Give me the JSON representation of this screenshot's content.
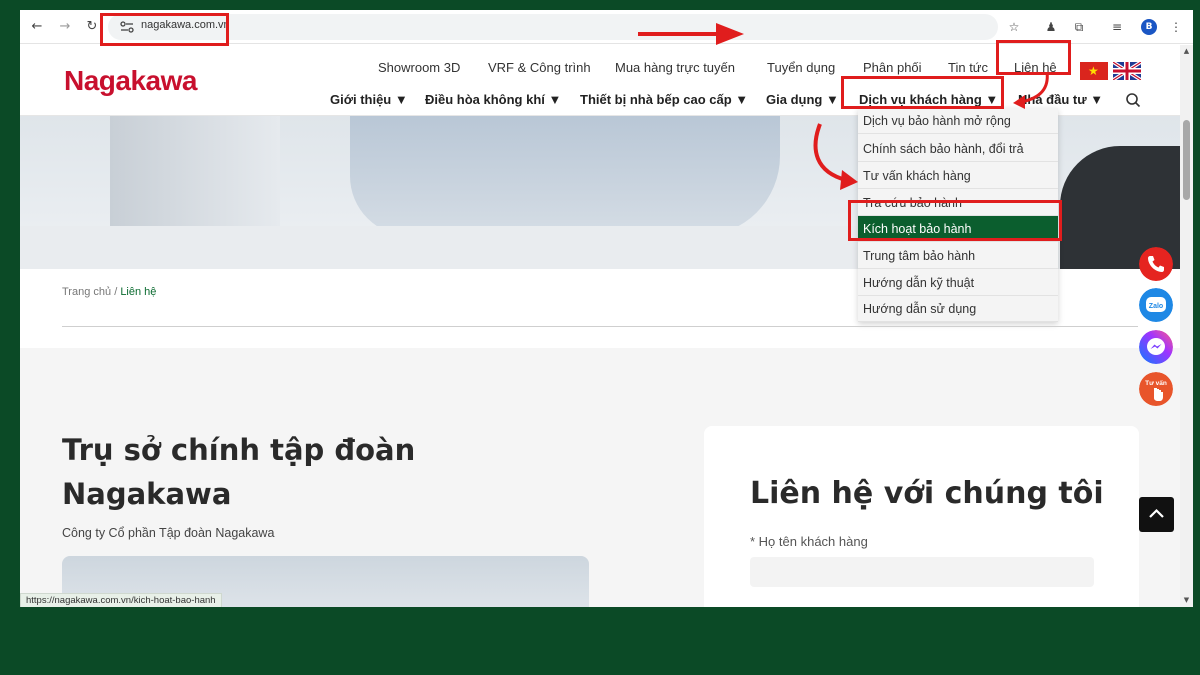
{
  "browser": {
    "url": "nagakawa.com.vn",
    "profile_initial": "B",
    "status_url": "https://nagakawa.com.vn/kich-hoat-bao-hanh"
  },
  "site": {
    "logo": "Nagakawa",
    "top_nav": [
      "Showroom 3D",
      "VRF & Công trình",
      "Mua hàng trực tuyến",
      "Tuyển dụng",
      "Phân phối",
      "Tin tức",
      "Liên hệ"
    ],
    "main_nav": [
      "Giới thiệu ▼",
      "Điều hòa không khí ▼",
      "Thiết bị nhà bếp cao cấp ▼",
      "Gia dụng ▼",
      "Dịch vụ khách hàng ▼",
      "Nhà đầu tư ▼"
    ],
    "dropdown_items": [
      "Dịch vụ bảo hành mở rộng",
      "Chính sách bảo hành, đổi trả",
      "Tư vấn khách hàng",
      "Tra cứu bảo hành",
      "Kích hoạt bảo hành",
      "Trung tâm bảo hành",
      "Hướng dẫn kỹ thuật",
      "Hướng dẫn sử dụng"
    ],
    "active_dropdown_index": 4
  },
  "breadcrumb": {
    "home": "Trang chủ",
    "separator": "/",
    "current": "Liên hệ"
  },
  "headquarters": {
    "title": "Trụ sở chính tập đoàn Nagakawa",
    "subtitle": "Công ty Cổ phần Tập đoàn Nagakawa"
  },
  "contact_form": {
    "title": "Liên hệ với chúng tôi",
    "name_label": "* Họ tên khách hàng"
  },
  "floating": {
    "zalo_label": "Zalo",
    "advice_label": "Tư vấn"
  },
  "colors": {
    "background": "#0b4a26",
    "brand_red": "#c8102e",
    "active_green": "#0b5e2e",
    "annotation_red": "#e01d1d"
  }
}
